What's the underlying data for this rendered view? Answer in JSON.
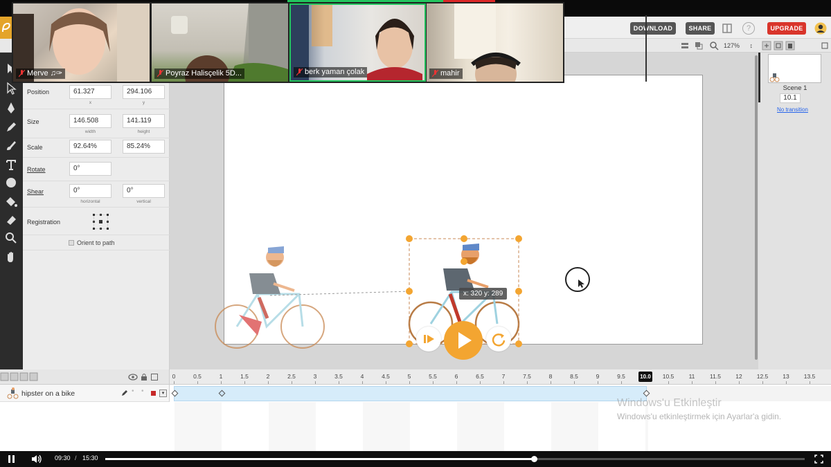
{
  "header": {
    "download_label": "DOWNLOAD",
    "share_label": "SHARE",
    "upgrade_label": "UPGRADE",
    "help_label": "?"
  },
  "toolbar": {
    "zoom": "127%"
  },
  "participants": [
    {
      "name": "Merve ♫✑"
    },
    {
      "name": "Poyraz Halisçelik 5D..."
    },
    {
      "name": "berk yaman çolak"
    },
    {
      "name": "mahir"
    }
  ],
  "properties": {
    "position_label": "Position",
    "position_x": "61.327",
    "position_y": "294.106",
    "x_sub": "x",
    "y_sub": "y",
    "size_label": "Size",
    "size_w": "146.508",
    "size_h": "141.119",
    "width_sub": "width",
    "height_sub": "height",
    "scale_label": "Scale",
    "scale_x": "92.64%",
    "scale_y": "85.24%",
    "rotate_label": "Rotate",
    "rotate_value": "0°",
    "shear_label": "Shear",
    "shear_h": "0°",
    "shear_v": "0°",
    "horizontal_sub": "horizontal",
    "vertical_sub": "vertical",
    "registration_label": "Registration",
    "orient_label": "Orient to path"
  },
  "stage": {
    "coord_tip": "x: 320  y: 289"
  },
  "scenes": {
    "name": "Scene 1",
    "duration": "10.1",
    "transition": "No transition"
  },
  "timeline": {
    "ticks": [
      "0",
      "0.5",
      "1",
      "1.5",
      "2",
      "2.5",
      "3",
      "3.5",
      "4",
      "4.5",
      "5",
      "5.5",
      "6",
      "6.5",
      "7",
      "7.5",
      "8",
      "8.5",
      "9",
      "9.5",
      "10.5",
      "11",
      "11.5",
      "12",
      "12.5",
      "13",
      "13.5"
    ],
    "playhead": "10.0",
    "layer_name": "hipster on a bike",
    "watermark_title": "Windows'u Etkinleştir",
    "watermark_body": "Windows'u etkinleştirmek için Ayarlar'a gidin."
  },
  "player": {
    "current_time": "09:30",
    "separator": "/",
    "total_time": "15:30",
    "progress": 0.613
  },
  "colors": {
    "accent": "#f3a531",
    "upgrade": "#d9352b",
    "tool_bg": "#2c2c2c"
  }
}
